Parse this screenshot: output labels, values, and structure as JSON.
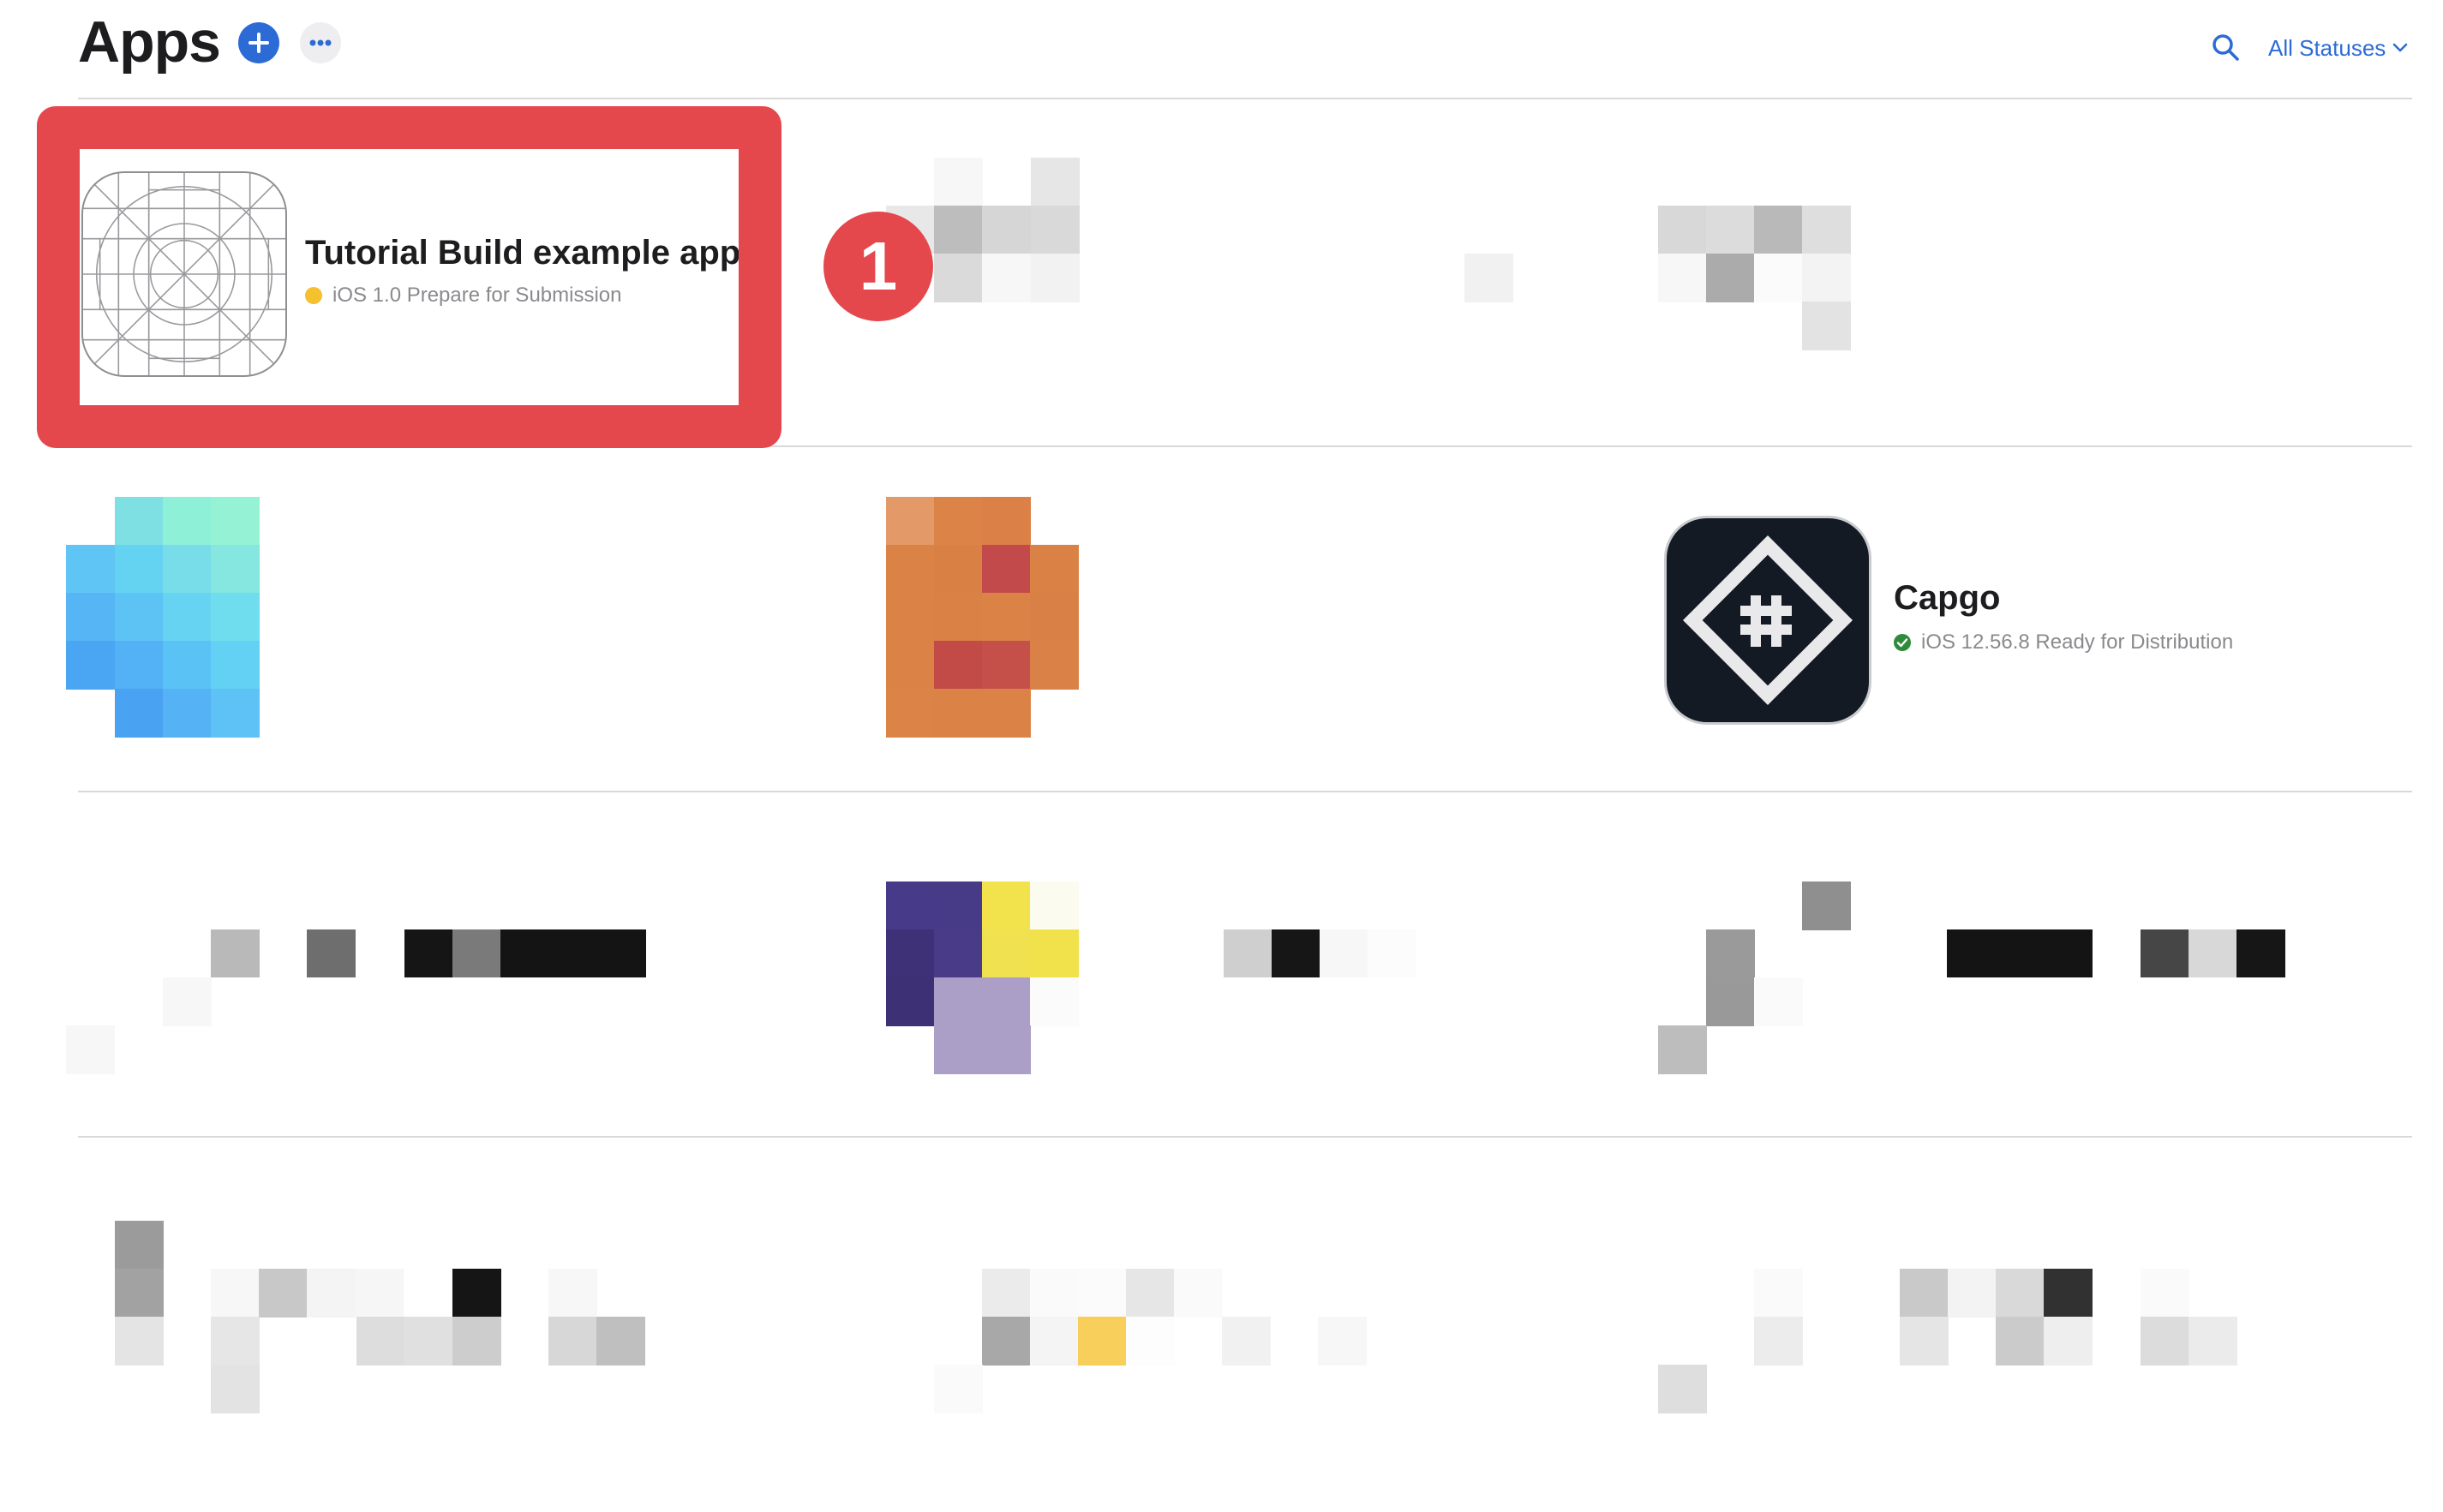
{
  "header": {
    "title": "Apps",
    "add_icon": "plus-icon",
    "more_icon": "ellipsis-icon",
    "search_icon": "magnifier-icon",
    "status_filter_label": "All Statuses",
    "status_filter_icon": "chevron-down-icon"
  },
  "apps": [
    {
      "name": "Tutorial Build example app",
      "status": "iOS 1.0 Prepare for Submission",
      "status_color": "#f5c12e",
      "icon": "app-icon-template-grid"
    },
    {
      "name": "Capgo",
      "status": "iOS 12.56.8 Ready for Distribution",
      "status_color": "#2e8b3a",
      "icon": "capgo-logo-icon"
    }
  ],
  "annotation": {
    "step_number": "1",
    "highlight_color": "#e4474c"
  },
  "colors": {
    "accent": "#2c6bd6",
    "divider": "#d9d9dc"
  }
}
